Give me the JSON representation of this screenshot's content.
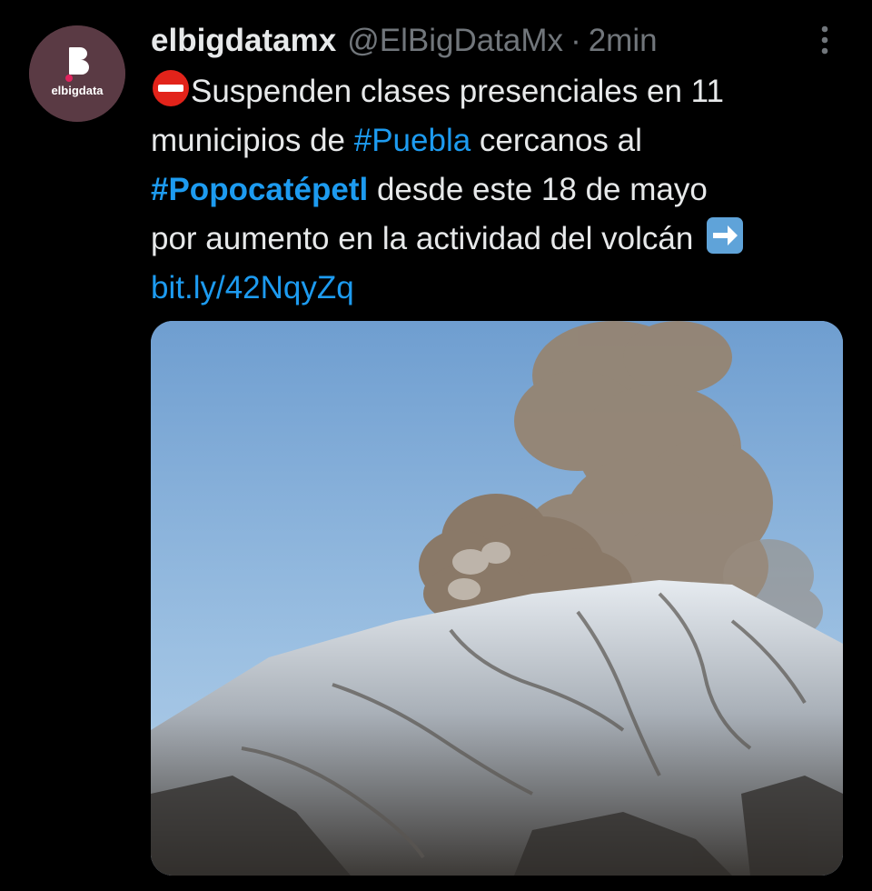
{
  "author": {
    "display_name": "elbigdatamx",
    "handle": "@ElBigDataMx",
    "separator": "·",
    "time": "2min",
    "avatar_text": "elbigdata",
    "avatar_color": "#5a3a44",
    "avatar_icon": "elbigdata-logo"
  },
  "tweet": {
    "line1": "Suspenden clases presenciales en 11",
    "line2_pre": "municipios de ",
    "hashtag1": "#Puebla",
    "line2_post": " cercanos al",
    "hashtag2": "#Popocatépetl",
    "line3_post": " desde este 18 de mayo",
    "line4": "por aumento en la actividad del volcán",
    "link": "bit.ly/42NqyZq"
  },
  "icons": {
    "no_entry": "no-entry-emoji",
    "arrow_right": "right-arrow-emoji",
    "more": "more-options-icon"
  },
  "colors": {
    "link": "#1d9bf0",
    "text": "#e7e9ea",
    "muted": "#71767b",
    "background": "#000000"
  },
  "media": {
    "alt": "volcano-eruption-photo"
  }
}
